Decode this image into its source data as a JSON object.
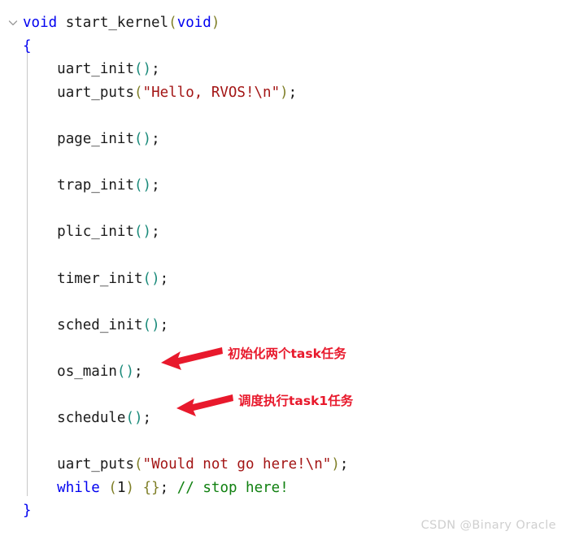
{
  "editor": {
    "language": "c",
    "background": "#ffffff",
    "fold_icon": "chevron-down-icon",
    "colors": {
      "keyword": "#0000f0",
      "string": "#a31515",
      "comment": "#108010",
      "paren": "#7f7f28",
      "paren_alt": "#1a8a7a",
      "brace": "#0000f0",
      "text": "#1a1a1a",
      "indent_guide": "#c8c8c8",
      "annotation_red": "#e8192c",
      "watermark": "#cfcfcf"
    },
    "lines": [
      {
        "indent": 0,
        "tokens": [
          {
            "t": "void",
            "c": "tok-type"
          },
          {
            "t": " ",
            "c": "tok-punct"
          },
          {
            "t": "start_kernel",
            "c": "tok-fn"
          },
          {
            "t": "(",
            "c": "tok-paren"
          },
          {
            "t": "void",
            "c": "tok-type"
          },
          {
            "t": ")",
            "c": "tok-paren"
          }
        ]
      },
      {
        "indent": 0,
        "tokens": [
          {
            "t": "{",
            "c": "tok-brace"
          }
        ]
      },
      {
        "indent": 1,
        "tokens": [
          {
            "t": "uart_init",
            "c": "tok-ident"
          },
          {
            "t": "(",
            "c": "tok-paren2"
          },
          {
            "t": ")",
            "c": "tok-paren2"
          },
          {
            "t": ";",
            "c": "tok-punct"
          }
        ]
      },
      {
        "indent": 1,
        "tokens": [
          {
            "t": "uart_puts",
            "c": "tok-ident"
          },
          {
            "t": "(",
            "c": "tok-paren"
          },
          {
            "t": "\"Hello, RVOS!\\n\"",
            "c": "tok-string"
          },
          {
            "t": ")",
            "c": "tok-paren"
          },
          {
            "t": ";",
            "c": "tok-punct"
          }
        ]
      },
      {
        "indent": 1,
        "tokens": []
      },
      {
        "indent": 1,
        "tokens": [
          {
            "t": "page_init",
            "c": "tok-ident"
          },
          {
            "t": "(",
            "c": "tok-paren2"
          },
          {
            "t": ")",
            "c": "tok-paren2"
          },
          {
            "t": ";",
            "c": "tok-punct"
          }
        ]
      },
      {
        "indent": 1,
        "tokens": []
      },
      {
        "indent": 1,
        "tokens": [
          {
            "t": "trap_init",
            "c": "tok-ident"
          },
          {
            "t": "(",
            "c": "tok-paren2"
          },
          {
            "t": ")",
            "c": "tok-paren2"
          },
          {
            "t": ";",
            "c": "tok-punct"
          }
        ]
      },
      {
        "indent": 1,
        "tokens": []
      },
      {
        "indent": 1,
        "tokens": [
          {
            "t": "plic_init",
            "c": "tok-ident"
          },
          {
            "t": "(",
            "c": "tok-paren2"
          },
          {
            "t": ")",
            "c": "tok-paren2"
          },
          {
            "t": ";",
            "c": "tok-punct"
          }
        ]
      },
      {
        "indent": 1,
        "tokens": []
      },
      {
        "indent": 1,
        "tokens": [
          {
            "t": "timer_init",
            "c": "tok-ident"
          },
          {
            "t": "(",
            "c": "tok-paren2"
          },
          {
            "t": ")",
            "c": "tok-paren2"
          },
          {
            "t": ";",
            "c": "tok-punct"
          }
        ]
      },
      {
        "indent": 1,
        "tokens": []
      },
      {
        "indent": 1,
        "tokens": [
          {
            "t": "sched_init",
            "c": "tok-ident"
          },
          {
            "t": "(",
            "c": "tok-paren2"
          },
          {
            "t": ")",
            "c": "tok-paren2"
          },
          {
            "t": ";",
            "c": "tok-punct"
          }
        ]
      },
      {
        "indent": 1,
        "tokens": []
      },
      {
        "indent": 1,
        "tokens": [
          {
            "t": "os_main",
            "c": "tok-ident"
          },
          {
            "t": "(",
            "c": "tok-paren2"
          },
          {
            "t": ")",
            "c": "tok-paren2"
          },
          {
            "t": ";",
            "c": "tok-punct"
          }
        ]
      },
      {
        "indent": 1,
        "tokens": []
      },
      {
        "indent": 1,
        "tokens": [
          {
            "t": "schedule",
            "c": "tok-ident"
          },
          {
            "t": "(",
            "c": "tok-paren2"
          },
          {
            "t": ")",
            "c": "tok-paren2"
          },
          {
            "t": ";",
            "c": "tok-punct"
          }
        ]
      },
      {
        "indent": 1,
        "tokens": []
      },
      {
        "indent": 1,
        "tokens": [
          {
            "t": "uart_puts",
            "c": "tok-ident"
          },
          {
            "t": "(",
            "c": "tok-paren"
          },
          {
            "t": "\"Would not go here!\\n\"",
            "c": "tok-string"
          },
          {
            "t": ")",
            "c": "tok-paren"
          },
          {
            "t": ";",
            "c": "tok-punct"
          }
        ]
      },
      {
        "indent": 1,
        "tokens": [
          {
            "t": "while",
            "c": "tok-keyword"
          },
          {
            "t": " ",
            "c": "tok-punct"
          },
          {
            "t": "(",
            "c": "tok-paren"
          },
          {
            "t": "1",
            "c": "tok-number"
          },
          {
            "t": ")",
            "c": "tok-paren"
          },
          {
            "t": " ",
            "c": "tok-punct"
          },
          {
            "t": "{",
            "c": "tok-brace2"
          },
          {
            "t": "}",
            "c": "tok-brace2"
          },
          {
            "t": ";",
            "c": "tok-punct"
          },
          {
            "t": " ",
            "c": "tok-punct"
          },
          {
            "t": "// stop here!",
            "c": "tok-comment"
          }
        ]
      },
      {
        "indent": 0,
        "tokens": [
          {
            "t": "}",
            "c": "tok-brace"
          }
        ]
      }
    ]
  },
  "annotations": [
    {
      "id": "annot-1",
      "text": "初始化两个task任务",
      "arrow": "arrow-left-icon",
      "target_line": "os_main();"
    },
    {
      "id": "annot-2",
      "text": "调度执行task1任务",
      "arrow": "arrow-left-icon",
      "target_line": "schedule();"
    }
  ],
  "watermark": {
    "text": "CSDN @Binary Oracle"
  }
}
